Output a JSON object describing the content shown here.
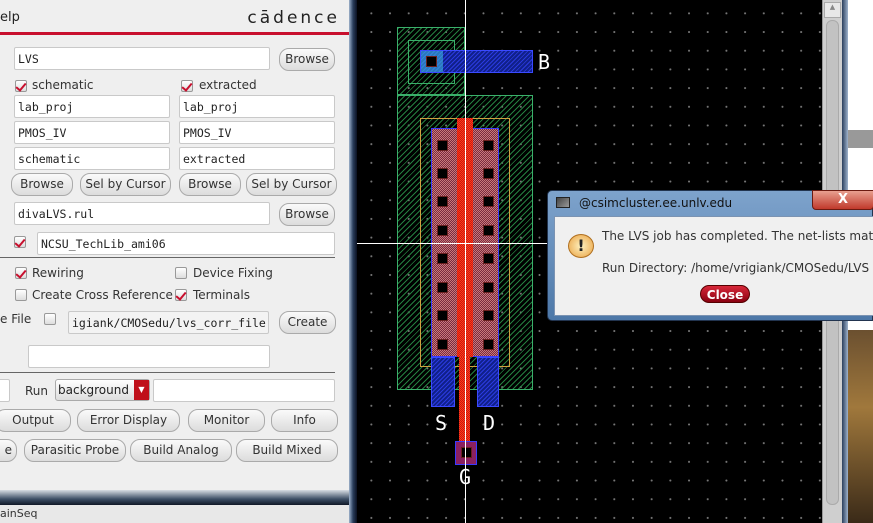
{
  "lvs_form": {
    "menu_partial": "elp",
    "logo": "cādence",
    "run_dir": "LVS",
    "browse": "Browse",
    "schematic": {
      "label": "schematic",
      "checked": true,
      "library": "lab_proj",
      "cell": "PMOS_IV",
      "view": "schematic"
    },
    "extracted": {
      "label": "extracted",
      "checked": true,
      "library": "lab_proj",
      "cell": "PMOS_IV",
      "view": "extracted"
    },
    "sel_by_cursor": "Sel by Cursor",
    "rules_file": "divaLVS.rul",
    "rules_lib_checked": true,
    "rules_library": "NCSU_TechLib_ami06",
    "rewiring": {
      "label": "Rewiring",
      "checked": true
    },
    "device_fixing": {
      "label": "Device Fixing",
      "checked": false
    },
    "cross_reference": {
      "label": "Create Cross Reference",
      "checked": false
    },
    "terminals": {
      "label": "Terminals",
      "checked": true
    },
    "corr_file_label": "e File",
    "corr_file_checked": false,
    "corr_file": "igiank/CMOSedu/lvs_corr_file",
    "create": "Create",
    "empty_field": "",
    "run_label": "Run",
    "run_mode": "background",
    "run_extra": "",
    "buttons_row1": [
      "Output",
      "Error Display",
      "Monitor",
      "Info"
    ],
    "buttons_row2": [
      "e",
      "Parasitic Probe",
      "Build Analog",
      "Build Mixed"
    ],
    "underlying_partial": "ainSeq"
  },
  "layout": {
    "pins": {
      "bulk": "B",
      "source": "S",
      "drain": "D",
      "gate": "G"
    },
    "colors": {
      "well": "#3ab06a",
      "poly": "#ff3a1a",
      "metal1": "#2a3adf",
      "select": "#d0a040"
    }
  },
  "dialog": {
    "title": "@csimcluster.ee.unlv.edu",
    "close_x": "X",
    "message": "The LVS job has completed. The net-lists match.",
    "run_directory": "Run Directory: /home/vrigiank/CMOSedu/LVS",
    "close_button": "Close"
  }
}
